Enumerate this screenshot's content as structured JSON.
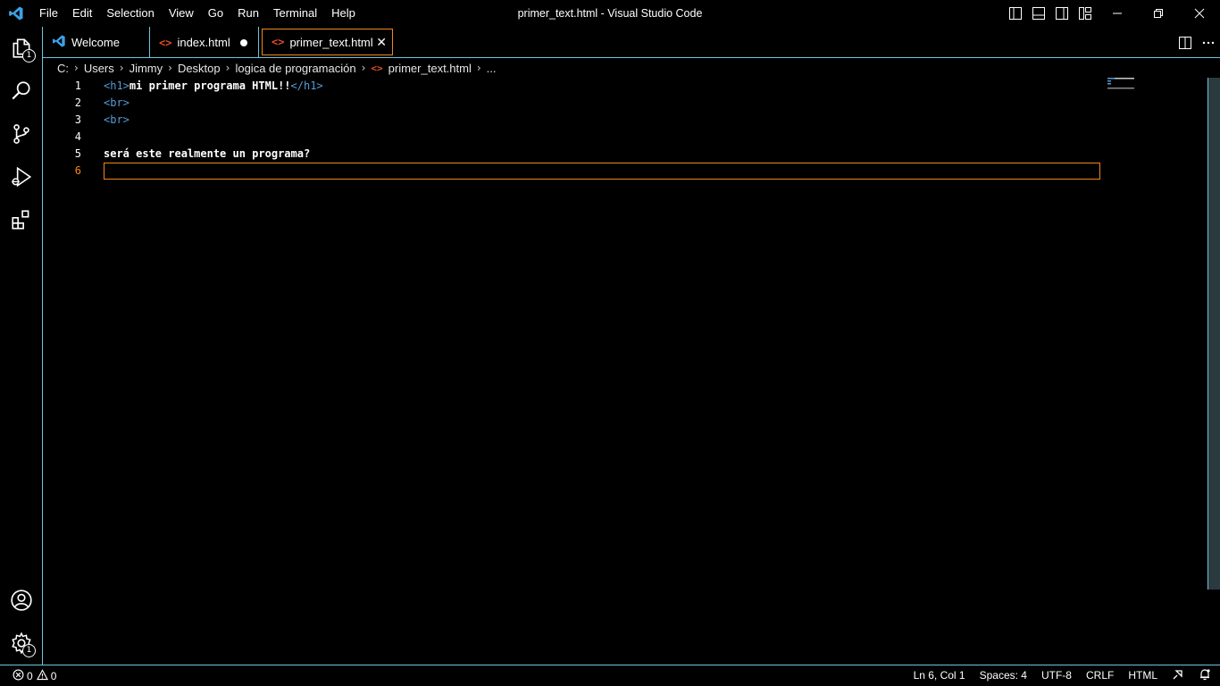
{
  "window": {
    "title": "primer_text.html - Visual Studio Code"
  },
  "menu": [
    "File",
    "Edit",
    "Selection",
    "View",
    "Go",
    "Run",
    "Terminal",
    "Help"
  ],
  "activity": {
    "explorer_badge": "1",
    "manage_badge": "1"
  },
  "tabs": [
    {
      "label": "Welcome",
      "icon": "vscode-logo-icon",
      "state": "normal"
    },
    {
      "label": "index.html",
      "icon": "html-file-icon",
      "state": "modified"
    },
    {
      "label": "primer_text.html",
      "icon": "html-file-icon",
      "state": "active",
      "close": "✕"
    }
  ],
  "breadcrumb": [
    "C:",
    "Users",
    "Jimmy",
    "Desktop",
    "logica de programación",
    "primer_text.html",
    "..."
  ],
  "editor": {
    "lines": [
      {
        "n": "1",
        "tag_open": "<h1>",
        "text": "mi primer programa HTML!!",
        "tag_close": "</h1>"
      },
      {
        "n": "2",
        "tag_open": "<br>",
        "text": "",
        "tag_close": ""
      },
      {
        "n": "3",
        "tag_open": "<br>",
        "text": "",
        "tag_close": ""
      },
      {
        "n": "4",
        "tag_open": "",
        "text": "",
        "tag_close": ""
      },
      {
        "n": "5",
        "tag_open": "",
        "text": "será este realmente un programa?",
        "tag_close": ""
      },
      {
        "n": "6",
        "tag_open": "",
        "text": "",
        "tag_close": ""
      }
    ]
  },
  "status": {
    "errors": "0",
    "warnings": "0",
    "position": "Ln 6, Col 1",
    "spaces": "Spaces: 4",
    "encoding": "UTF-8",
    "eol": "CRLF",
    "language": "HTML"
  },
  "colors": {
    "accent": "#6fc3df",
    "focus": "#f38518",
    "tag": "#569cd6",
    "logo": "#3ca1e8",
    "html_icon": "#e44d26"
  }
}
